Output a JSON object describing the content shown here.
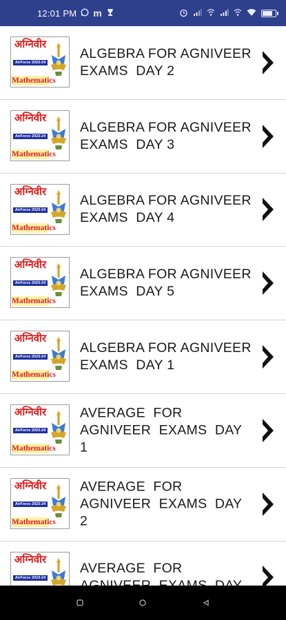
{
  "status_bar": {
    "time": "12:01 PM",
    "left_icons": [
      "whatsapp-icon",
      "m-icon",
      "trophy-icon"
    ],
    "right_icons": [
      "alarm-icon",
      "signal-icon",
      "wifi-calling-icon",
      "signal-icon-2",
      "wifi-calling-icon-2",
      "wifi-icon",
      "battery-icon"
    ]
  },
  "thumbnail": {
    "hindi_title": "अग्निवीर",
    "band_text": "AirForce 2023-24",
    "subject": "Mathematics",
    "emblem_icon": "air-force-emblem-icon"
  },
  "items": [
    {
      "title": "ALGEBRA FOR AGNIVEER EXAMS  DAY 2"
    },
    {
      "title": "ALGEBRA FOR AGNIVEER EXAMS  DAY 3"
    },
    {
      "title": "ALGEBRA FOR AGNIVEER EXAMS  DAY 4"
    },
    {
      "title": "ALGEBRA FOR AGNIVEER EXAMS  DAY 5"
    },
    {
      "title": "ALGEBRA FOR AGNIVEER EXAMS  DAY 1"
    },
    {
      "title": "AVERAGE  FOR AGNIVEER  EXAMS  DAY 1"
    },
    {
      "title": "AVERAGE  FOR AGNIVEER  EXAMS  DAY 2"
    },
    {
      "title": "AVERAGE  FOR AGNIVEER  EXAMS  DAY"
    }
  ],
  "nav_bar": {
    "buttons": [
      "recent-apps-icon",
      "home-icon",
      "back-icon"
    ]
  },
  "colors": {
    "status_bar_bg": "#2e3f8c",
    "thumbnail_red": "#e01b1b",
    "thumbnail_blue": "#1d2fa0",
    "text": "#1a1a1a",
    "nav_bg": "#000000"
  }
}
